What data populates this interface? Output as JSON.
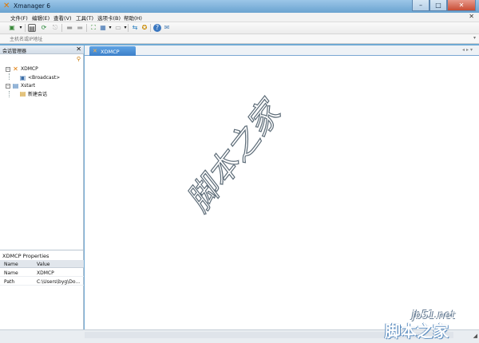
{
  "window": {
    "title": "Xmanager 6"
  },
  "menu": {
    "items": [
      "文件(F)",
      "编辑(E)",
      "查看(V)",
      "工具(T)",
      "选项卡(B)",
      "帮助(H)"
    ]
  },
  "addressbar": {
    "placeholder": "主机名或IP地址"
  },
  "session_panel": {
    "title": "会话管理器",
    "tree": [
      {
        "label": "XDMCP",
        "children": [
          {
            "label": "<Broadcast>"
          }
        ]
      },
      {
        "label": "Xstart",
        "children": [
          {
            "label": "新建会话"
          }
        ]
      }
    ]
  },
  "properties": {
    "title": "XDMCP Properties",
    "columns": [
      "Name",
      "Value"
    ],
    "rows": [
      [
        "Name",
        "XDMCP"
      ],
      [
        "Path",
        "C:\\Users\\byg\\Do..."
      ]
    ]
  },
  "tabs": [
    {
      "label": "XDMCP"
    }
  ],
  "watermark": {
    "text": "脚本之家"
  },
  "site": {
    "domain": "jb51.net",
    "name": "脚本之家"
  },
  "colors": {
    "accent": "#3c7fc9",
    "title_bar": "#6aa3d0",
    "icon_orange": "#e07800"
  }
}
